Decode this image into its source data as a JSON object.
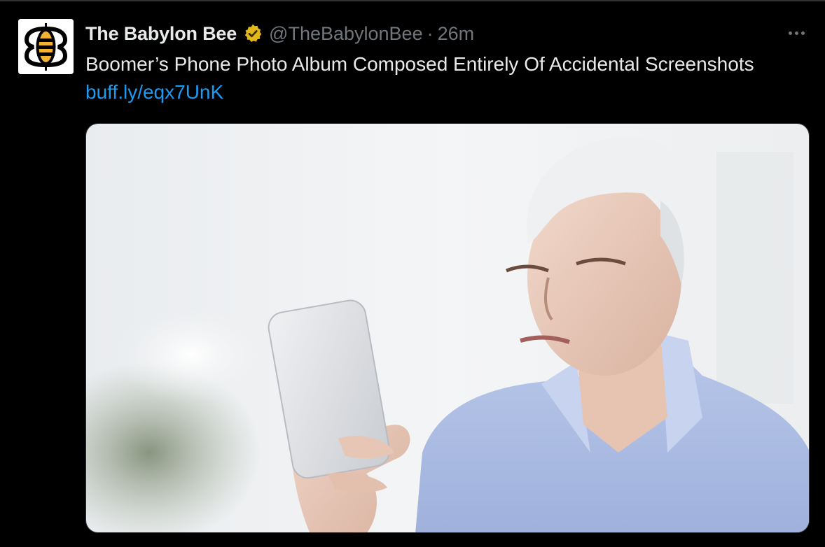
{
  "tweet": {
    "author": {
      "display_name": "The Babylon Bee",
      "handle": "@TheBabylonBee",
      "verified_badge_icon": "gold-checkmark-badge-icon",
      "avatar_icon": "bee-logo-icon"
    },
    "separator": "·",
    "timestamp": "26m",
    "text": "Boomer’s Phone Photo Album Composed Entirely Of Accidental Screenshots",
    "link": "buff.ly/eqx7UnK",
    "more_icon": "more-options-icon",
    "media": {
      "icon": "photo-image",
      "description_alt": ""
    }
  },
  "colors": {
    "background": "#000000",
    "primary_text": "#e7e9ea",
    "secondary_text": "#71767b",
    "link": "#1d9bf0",
    "verified_gold": "#e2b719"
  }
}
